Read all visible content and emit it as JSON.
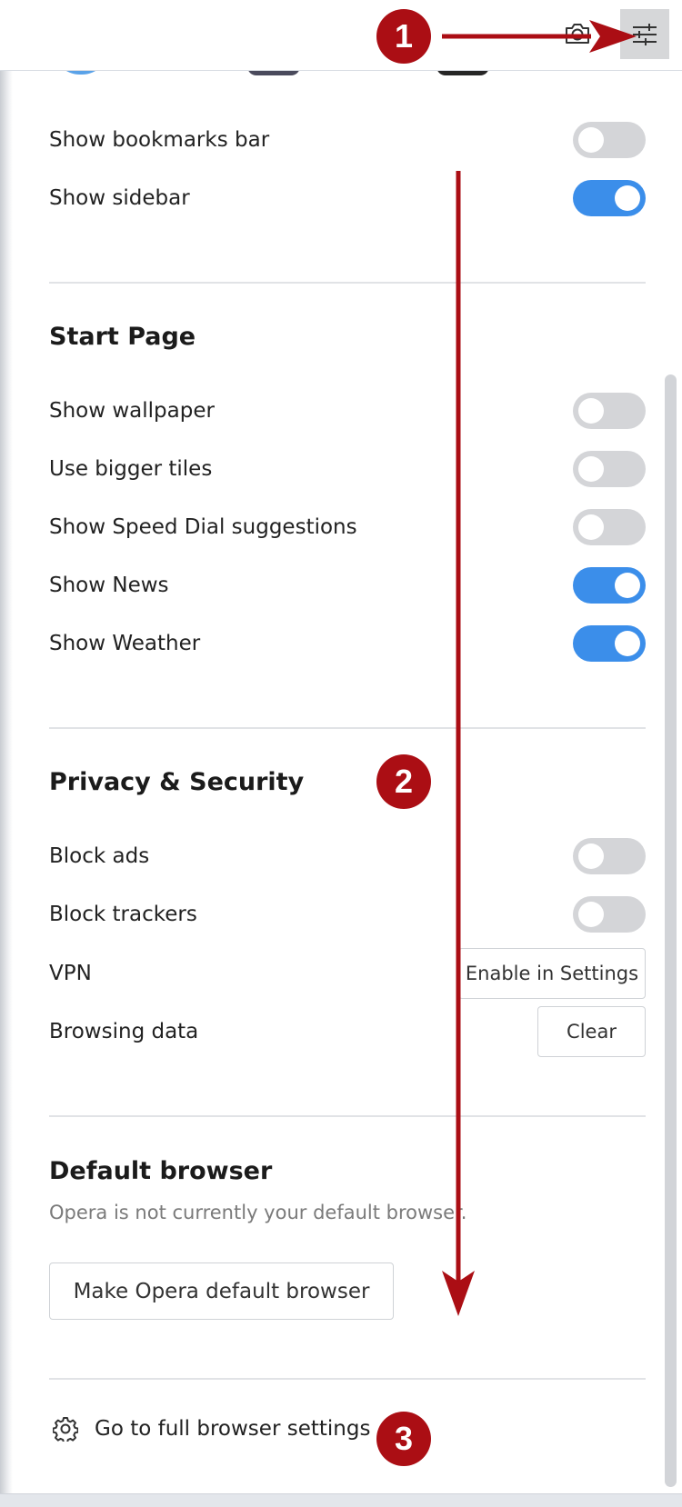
{
  "toolbar": {
    "camera_icon": "camera-icon",
    "settings_icon": "sliders-icon"
  },
  "appearance": {
    "rows": [
      {
        "label": "Show bookmarks bar",
        "on": false
      },
      {
        "label": "Show sidebar",
        "on": true
      }
    ]
  },
  "start_page": {
    "title": "Start Page",
    "rows": [
      {
        "label": "Show wallpaper",
        "on": false
      },
      {
        "label": "Use bigger tiles",
        "on": false
      },
      {
        "label": "Show Speed Dial suggestions",
        "on": false
      },
      {
        "label": "Show News",
        "on": true
      },
      {
        "label": "Show Weather",
        "on": true
      }
    ]
  },
  "privacy": {
    "title": "Privacy & Security",
    "rows": [
      {
        "label": "Block ads",
        "on": false
      },
      {
        "label": "Block trackers",
        "on": false
      }
    ],
    "vpn": {
      "label": "VPN",
      "button": "Enable in Settings"
    },
    "browsing_data": {
      "label": "Browsing data",
      "button": "Clear"
    }
  },
  "default_browser": {
    "title": "Default browser",
    "note": "Opera is not currently your default browser.",
    "button": "Make Opera default browser"
  },
  "footer": {
    "icon": "gear-icon",
    "label": "Go to full browser settings"
  },
  "annotations": {
    "badges": [
      "1",
      "2",
      "3"
    ],
    "color": "#ab0e14"
  },
  "colors": {
    "toggle_on": "#3b8eea",
    "toggle_off": "#d4d5d8",
    "annotation": "#ab0e14"
  }
}
